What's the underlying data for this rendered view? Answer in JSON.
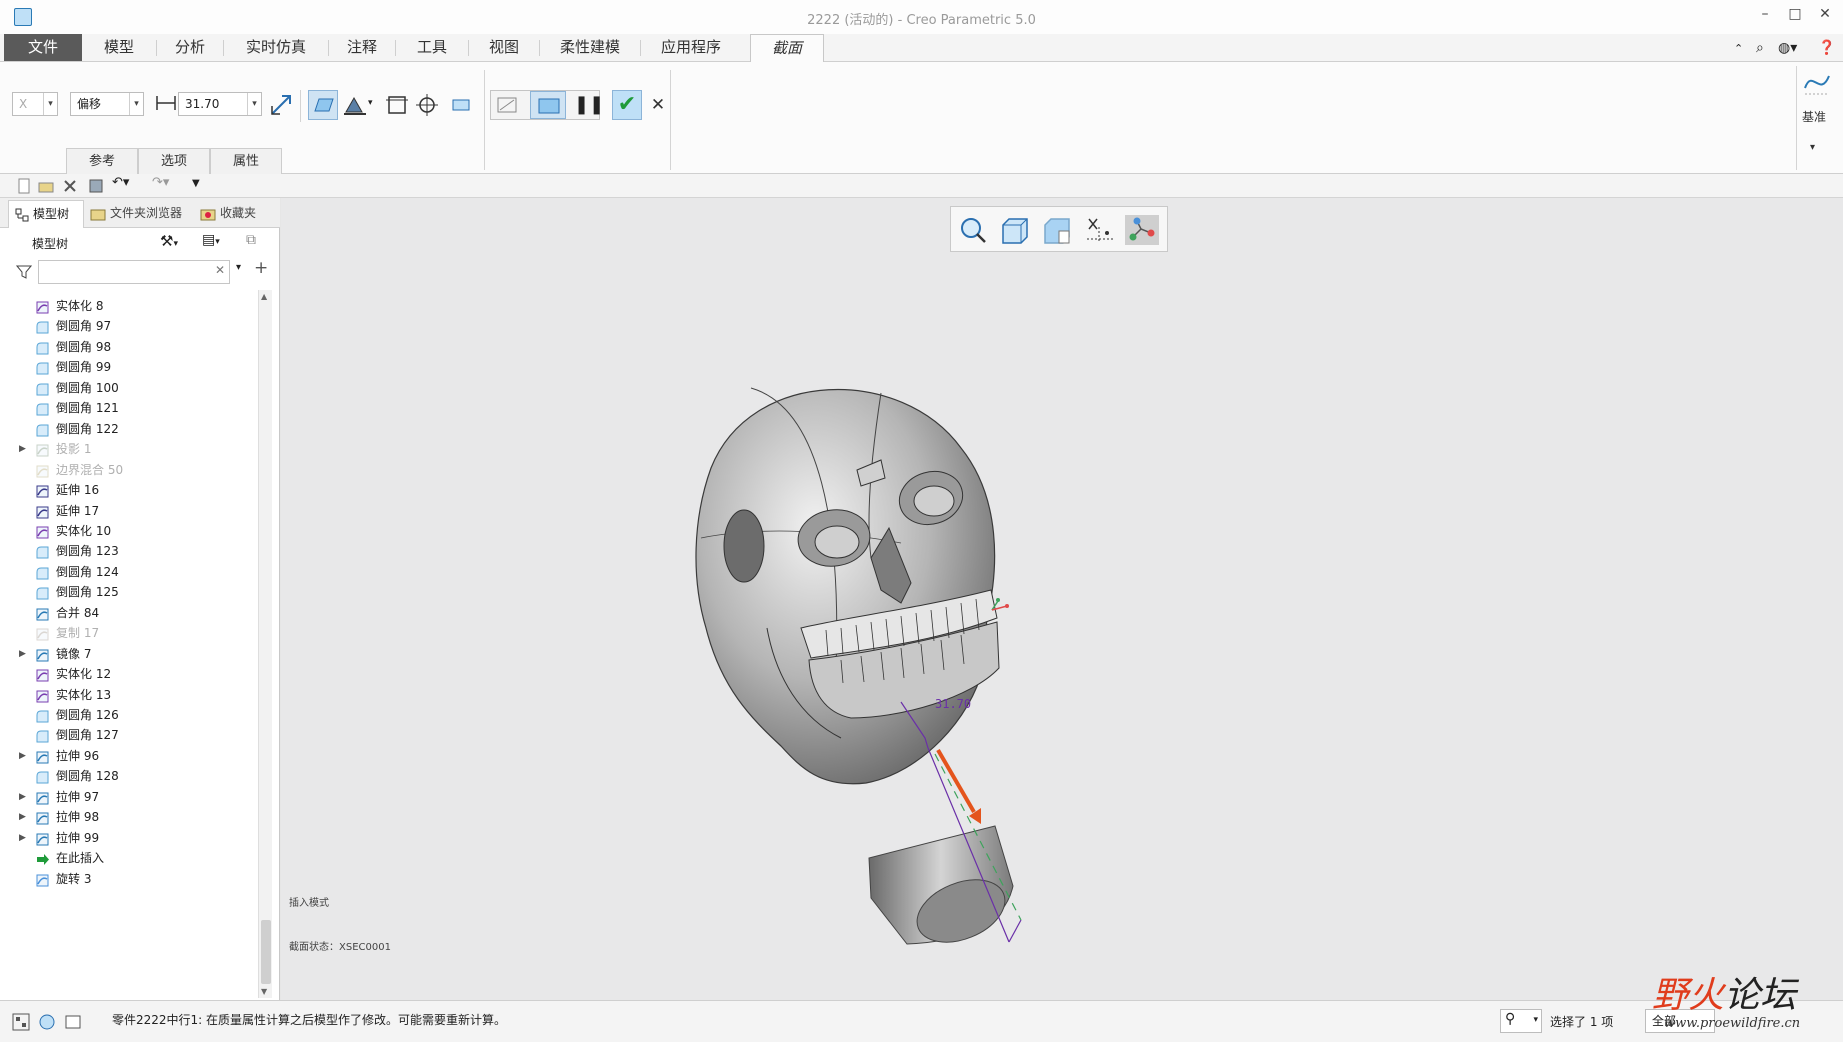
{
  "window": {
    "title": "2222 (活动的) - Creo Parametric 5.0"
  },
  "ribbon_tabs": [
    "文件",
    "模型",
    "分析",
    "实时仿真",
    "注释",
    "工具",
    "视图",
    "柔性建模",
    "应用程序",
    "截面"
  ],
  "ribbon": {
    "axis_value": "X",
    "mode_select": "偏移",
    "offset_value": "31.70",
    "subtabs": [
      "参考",
      "选项",
      "属性"
    ],
    "datum_label": "基准"
  },
  "panel_tabs": [
    "模型树",
    "文件夹浏览器",
    "收藏夹"
  ],
  "tree": {
    "header": "模型树",
    "filter_placeholder": "",
    "items": [
      {
        "label": "实体化 8",
        "icon": "solidify-icon",
        "dim": false,
        "expandable": false
      },
      {
        "label": "倒圆角 97",
        "icon": "round-icon",
        "dim": false,
        "expandable": false
      },
      {
        "label": "倒圆角 98",
        "icon": "round-icon",
        "dim": false,
        "expandable": false
      },
      {
        "label": "倒圆角 99",
        "icon": "round-icon",
        "dim": false,
        "expandable": false
      },
      {
        "label": "倒圆角 100",
        "icon": "round-icon",
        "dim": false,
        "expandable": false
      },
      {
        "label": "倒圆角 121",
        "icon": "round-icon",
        "dim": false,
        "expandable": false
      },
      {
        "label": "倒圆角 122",
        "icon": "round-icon",
        "dim": false,
        "expandable": false
      },
      {
        "label": "投影 1",
        "icon": "projection-icon",
        "dim": true,
        "expandable": true
      },
      {
        "label": "边界混合 50",
        "icon": "boundary-blend-icon",
        "dim": true,
        "expandable": false
      },
      {
        "label": "延伸 16",
        "icon": "extend-icon",
        "dim": false,
        "expandable": false
      },
      {
        "label": "延伸 17",
        "icon": "extend-icon",
        "dim": false,
        "expandable": false
      },
      {
        "label": "实体化 10",
        "icon": "solidify-icon",
        "dim": false,
        "expandable": false
      },
      {
        "label": "倒圆角 123",
        "icon": "round-icon",
        "dim": false,
        "expandable": false
      },
      {
        "label": "倒圆角 124",
        "icon": "round-icon",
        "dim": false,
        "expandable": false
      },
      {
        "label": "倒圆角 125",
        "icon": "round-icon",
        "dim": false,
        "expandable": false
      },
      {
        "label": "合并 84",
        "icon": "merge-icon",
        "dim": false,
        "expandable": false
      },
      {
        "label": "复制 17",
        "icon": "copy-icon",
        "dim": true,
        "expandable": false
      },
      {
        "label": "镜像 7",
        "icon": "mirror-icon",
        "dim": false,
        "expandable": true
      },
      {
        "label": "实体化 12",
        "icon": "solidify-icon",
        "dim": false,
        "expandable": false
      },
      {
        "label": "实体化 13",
        "icon": "solidify-icon",
        "dim": false,
        "expandable": false
      },
      {
        "label": "倒圆角 126",
        "icon": "round-icon",
        "dim": false,
        "expandable": false
      },
      {
        "label": "倒圆角 127",
        "icon": "round-icon",
        "dim": false,
        "expandable": false
      },
      {
        "label": "拉伸 96",
        "icon": "extrude-icon",
        "dim": false,
        "expandable": true
      },
      {
        "label": "倒圆角 128",
        "icon": "round-icon",
        "dim": false,
        "expandable": false
      },
      {
        "label": "拉伸 97",
        "icon": "extrude-icon",
        "dim": false,
        "expandable": true
      },
      {
        "label": "拉伸 98",
        "icon": "extrude-icon",
        "dim": false,
        "expandable": true
      },
      {
        "label": "拉伸 99",
        "icon": "extrude-icon",
        "dim": false,
        "expandable": true
      },
      {
        "label": "在此插入",
        "icon": "insert-here-icon",
        "dim": false,
        "expandable": false
      },
      {
        "label": "旋转 3",
        "icon": "revolve-icon",
        "dim": false,
        "expandable": false
      }
    ]
  },
  "viewport": {
    "dimension_label": "31.70",
    "label_insert_mode": "插入模式",
    "label_section": "截面状态：XSEC0001"
  },
  "status": {
    "message": "零件2222中行1: 在质量属性计算之后模型作了修改。可能需要重新计算。",
    "selection": "选择了 1 项",
    "filter": "全部"
  },
  "watermark": {
    "text": "野火论坛",
    "url": "www.proewildfire.cn"
  },
  "colors": {
    "accent": "#2a7ab5",
    "confirm": "#1f9b3a",
    "arrow": "#e4541c"
  }
}
